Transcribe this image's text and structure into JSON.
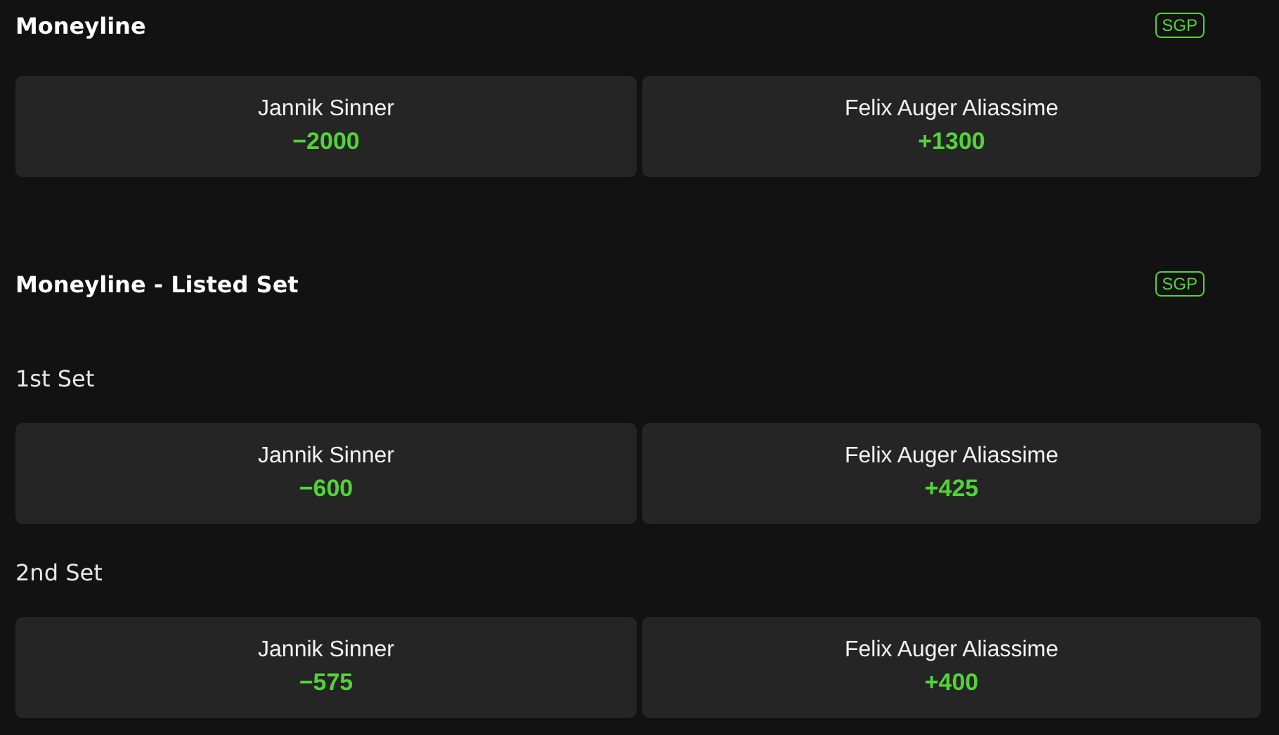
{
  "markets": [
    {
      "title": "Moneyline",
      "badge": "SGP",
      "groups": [
        {
          "outcomes": [
            {
              "name": "Jannik Sinner",
              "odds": "−2000"
            },
            {
              "name": "Felix Auger Aliassime",
              "odds": "+1300"
            }
          ]
        }
      ]
    },
    {
      "title": "Moneyline - Listed Set",
      "badge": "SGP",
      "groups": [
        {
          "label": "1st Set",
          "outcomes": [
            {
              "name": "Jannik Sinner",
              "odds": "−600"
            },
            {
              "name": "Felix Auger Aliassime",
              "odds": "+425"
            }
          ]
        },
        {
          "label": "2nd Set",
          "outcomes": [
            {
              "name": "Jannik Sinner",
              "odds": "−575"
            },
            {
              "name": "Felix Auger Aliassime",
              "odds": "+400"
            }
          ]
        }
      ]
    }
  ]
}
